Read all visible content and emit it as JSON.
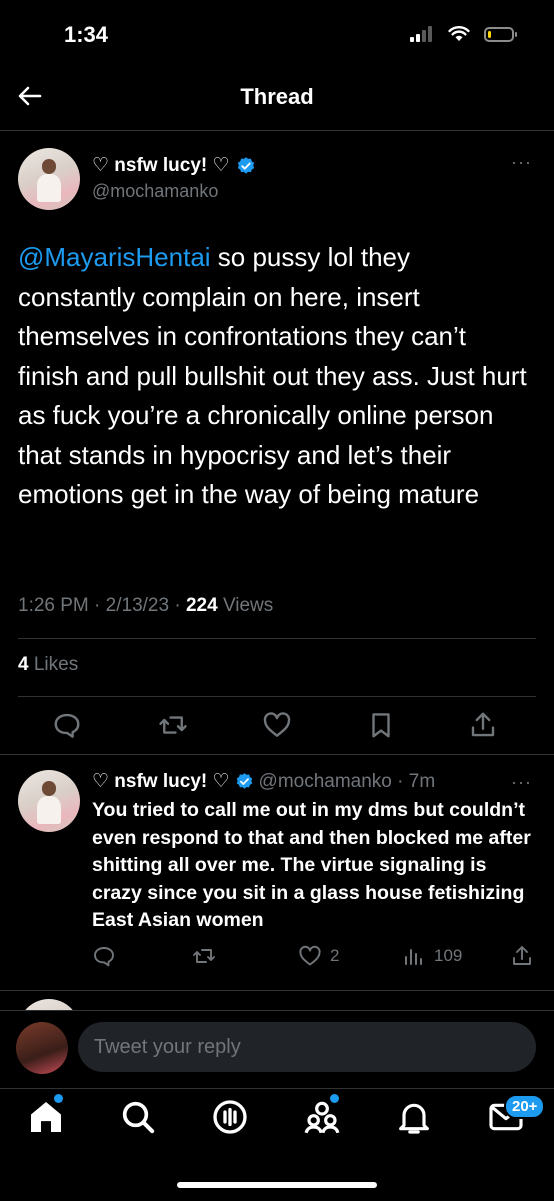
{
  "status_bar": {
    "time": "1:34",
    "battery_level": 0.15,
    "battery_color": "#ffd60a"
  },
  "header": {
    "title": "Thread"
  },
  "main_tweet": {
    "display_name": "♡ nsfw lucy! ♡",
    "handle": "@mochamanko",
    "mention": "@MayarisHentai",
    "text": " so pussy lol they constantly complain on here, insert themselves in confrontations they can’t finish and pull bullshit out they ass. Just hurt as fuck you’re a chronically online person that stands in hypocrisy and let’s their emotions get in the way of being mature",
    "time": "1:26 PM",
    "date": "2/13/23",
    "views_count": "224",
    "views_label": "Views",
    "likes_count": "4",
    "likes_label": "Likes",
    "more": "···"
  },
  "reply": {
    "display_name": "♡ nsfw lucy! ♡",
    "handle": "@mochamanko",
    "age": "7m",
    "text": "You tried to call me out in my dms but couldn’t even respond to that and then blocked me after shitting all over me. The virtue signaling is crazy since you sit in a glass house fetishizing East Asian women",
    "likes": "2",
    "views": "109",
    "more": "···"
  },
  "compose": {
    "placeholder": "Tweet your reply"
  },
  "tabbar": {
    "messages_badge": "20+"
  },
  "colors": {
    "accent": "#1d9bf0",
    "background": "#000000",
    "muted": "#71767b"
  }
}
